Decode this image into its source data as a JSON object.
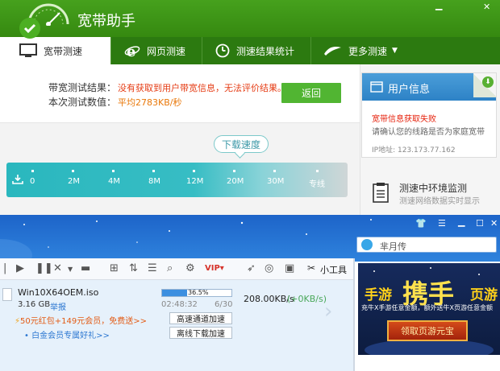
{
  "app": {
    "title": "宽带助手"
  },
  "nav": {
    "tabs": [
      {
        "label": "宽带测速",
        "icon": "monitor-icon"
      },
      {
        "label": "网页测速",
        "icon": "ie-icon"
      },
      {
        "label": "测速结果统计",
        "icon": "clock-icon"
      },
      {
        "label": "更多测速",
        "icon": "wing-icon"
      }
    ]
  },
  "result": {
    "bandwidth_label": "带宽测试结果：",
    "bandwidth_value": "没有获取到用户带宽信息，无法评价结果。",
    "speed_label": "本次测试数值：",
    "speed_value": "平均2783KB/秒",
    "return_button": "返回"
  },
  "gauge": {
    "title": "下载速度",
    "ticks": [
      "0",
      "2M",
      "4M",
      "8M",
      "12M",
      "20M",
      "30M",
      "专线"
    ]
  },
  "user_info": {
    "title": "用户信息",
    "error": "宽带信息获取失败",
    "hint": "请确认您的线路是否为家庭宽带",
    "ip": "IP地址: 123.173.77.162"
  },
  "monitor": {
    "title": "测速中环境监测",
    "subtitle": "测速网络数据实时显示"
  },
  "downloader": {
    "search_text": "芈月传",
    "toolbar_label": "小工具",
    "file": {
      "name": "Win10X64OEM.iso",
      "size": "3.16 GB",
      "report": "举报",
      "progress_percent": 36.5,
      "progress_label": "36.5%",
      "time_left": "02:48:32",
      "pieces": "6/30",
      "speed": "208.00KB/s",
      "speed_up": "(+0KB/s)",
      "channel_button": "高速通道加速",
      "offline_button": "离线下载加速",
      "promo_red": "50元红包+149元会员，免费送>>",
      "promo_blue": "白金会员专属好礼>>"
    },
    "ad": {
      "left": "手游",
      "center": "携手",
      "right": "页游",
      "subtitle": "充牛X手游任意金额，额外送牛X页游任意金额",
      "button": "领取页游元宝"
    }
  }
}
